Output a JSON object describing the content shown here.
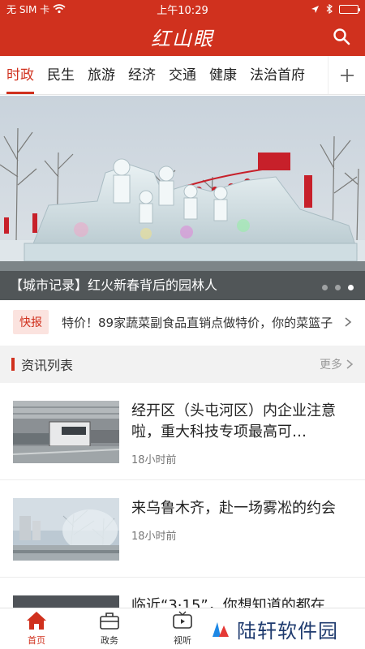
{
  "status": {
    "carrier": "无 SIM 卡",
    "time": "上午10:29"
  },
  "header": {
    "app_title": "红山眼"
  },
  "tabs": [
    {
      "label": "时政",
      "active": true
    },
    {
      "label": "民生"
    },
    {
      "label": "旅游"
    },
    {
      "label": "经济"
    },
    {
      "label": "交通"
    },
    {
      "label": "健康"
    },
    {
      "label": "法治首府"
    }
  ],
  "banner": {
    "caption": "【城市记录】红火新春背后的园林人",
    "slide_count": 3,
    "active_slide": 3
  },
  "flash": {
    "badge": "快报",
    "text": "特价！89家蔬菜副食品直销点做特价，你的菜篮子"
  },
  "section": {
    "title": "资讯列表",
    "more": "更多"
  },
  "news": [
    {
      "title": "经开区（头屯河区）内企业注意啦，重大科技专项最高可…",
      "time": "18小时前"
    },
    {
      "title": "来乌鲁木齐，赴一场雾凇的约会",
      "time": "18小时前"
    },
    {
      "title": "临近“3·15”，你想知道的都在",
      "time": ""
    }
  ],
  "bottom_nav": [
    {
      "label": "首页",
      "active": true
    },
    {
      "label": "政务"
    },
    {
      "label": "视听"
    }
  ],
  "watermark": {
    "text": "陆轩软件园"
  },
  "colors": {
    "brand_red": "#d0311e",
    "section_bg": "#f2f2f2"
  }
}
